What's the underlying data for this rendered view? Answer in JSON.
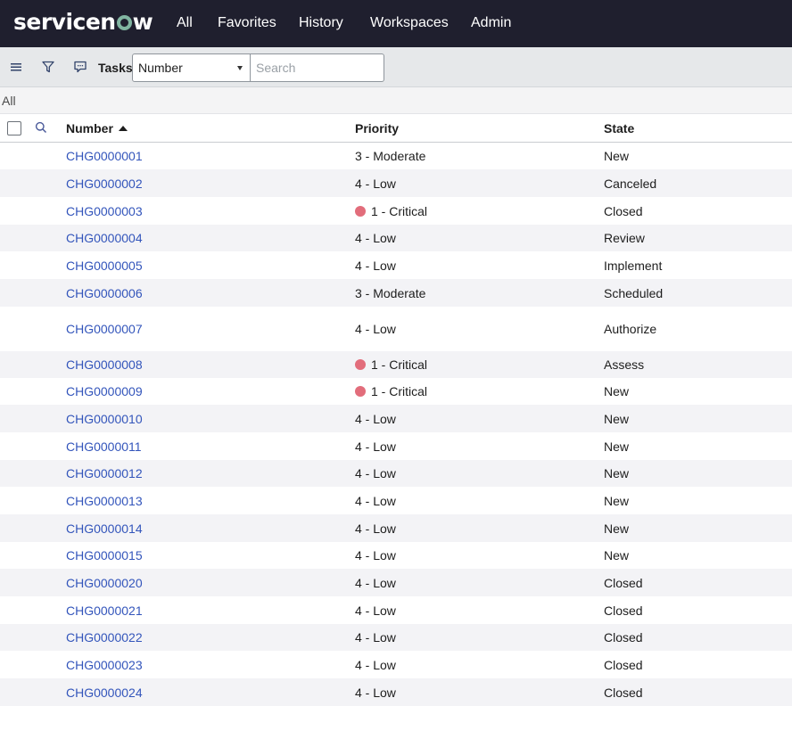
{
  "brand": {
    "logo_prefix": "servicen",
    "logo_suffix": "w"
  },
  "nav": [
    "All",
    "Favorites",
    "History",
    "Workspaces",
    "Admin"
  ],
  "toolbar": {
    "menu_icon": "hamburger-icon",
    "filter_icon": "filter-icon",
    "chat_icon": "comment-icon",
    "list_title": "Tasks",
    "field_select": "Number",
    "search_placeholder": "Search"
  },
  "breadcrumb": "All",
  "table": {
    "columns": {
      "number": "Number",
      "priority": "Priority",
      "state": "State"
    },
    "rows": [
      {
        "number": "CHG0000001",
        "priority": "3 - Moderate",
        "critical": false,
        "state": "New"
      },
      {
        "number": "CHG0000002",
        "priority": "4 - Low",
        "critical": false,
        "state": "Canceled"
      },
      {
        "number": "CHG0000003",
        "priority": "1 - Critical",
        "critical": true,
        "state": "Closed"
      },
      {
        "number": "CHG0000004",
        "priority": "4 - Low",
        "critical": false,
        "state": "Review"
      },
      {
        "number": "CHG0000005",
        "priority": "4 - Low",
        "critical": false,
        "state": "Implement"
      },
      {
        "number": "CHG0000006",
        "priority": "3 - Moderate",
        "critical": false,
        "state": "Scheduled"
      },
      {
        "number": "CHG0000007",
        "priority": "4 - Low",
        "critical": false,
        "state": "Authorize"
      },
      {
        "number": "CHG0000008",
        "priority": "1 - Critical",
        "critical": true,
        "state": "Assess"
      },
      {
        "number": "CHG0000009",
        "priority": "1 - Critical",
        "critical": true,
        "state": "New"
      },
      {
        "number": "CHG0000010",
        "priority": "4 - Low",
        "critical": false,
        "state": "New"
      },
      {
        "number": "CHG0000011",
        "priority": "4 - Low",
        "critical": false,
        "state": "New"
      },
      {
        "number": "CHG0000012",
        "priority": "4 - Low",
        "critical": false,
        "state": "New"
      },
      {
        "number": "CHG0000013",
        "priority": "4 - Low",
        "critical": false,
        "state": "New"
      },
      {
        "number": "CHG0000014",
        "priority": "4 - Low",
        "critical": false,
        "state": "New"
      },
      {
        "number": "CHG0000015",
        "priority": "4 - Low",
        "critical": false,
        "state": "New"
      },
      {
        "number": "CHG0000020",
        "priority": "4 - Low",
        "critical": false,
        "state": "Closed"
      },
      {
        "number": "CHG0000021",
        "priority": "4 - Low",
        "critical": false,
        "state": "Closed"
      },
      {
        "number": "CHG0000022",
        "priority": "4 - Low",
        "critical": false,
        "state": "Closed"
      },
      {
        "number": "CHG0000023",
        "priority": "4 - Low",
        "critical": false,
        "state": "Closed"
      },
      {
        "number": "CHG0000024",
        "priority": "4 - Low",
        "critical": false,
        "state": "Closed"
      }
    ]
  },
  "colors": {
    "nav_bg": "#1f1f2e",
    "link": "#3355bb",
    "critical_dot": "#e26d7b",
    "logo_accent": "#81b5a1"
  }
}
